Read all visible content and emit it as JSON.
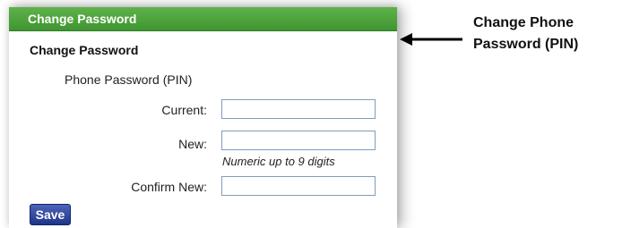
{
  "panel": {
    "header_title": "Change Password",
    "section_title": "Change Password",
    "group_label": "Phone Password (PIN)",
    "fields": {
      "current": {
        "label": "Current:",
        "value": ""
      },
      "new": {
        "label": "New:",
        "value": "",
        "hint": "Numeric up to 9 digits"
      },
      "confirm": {
        "label": "Confirm New:",
        "value": ""
      }
    },
    "save_label": "Save"
  },
  "annotation": {
    "line1": "Change Phone",
    "line2": "Password (PIN)"
  },
  "colors": {
    "header_green": "#4aa339",
    "button_blue": "#2a3f97",
    "input_border": "#7f9db9"
  },
  "icons": [
    "arrow-left-icon"
  ]
}
